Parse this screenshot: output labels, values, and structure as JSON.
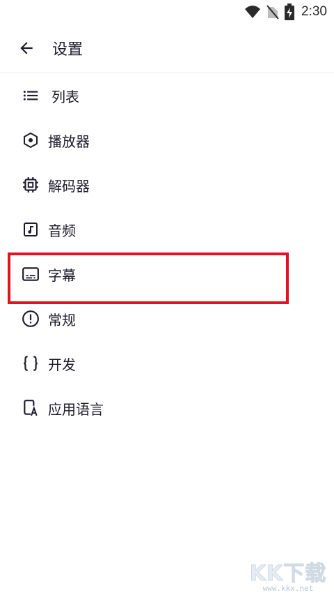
{
  "status_bar": {
    "time": "2:30",
    "icons": [
      "wifi-icon",
      "no-sim-icon",
      "battery-charging-icon"
    ]
  },
  "app_bar": {
    "back_icon": "arrow-left-icon",
    "title": "设置"
  },
  "menu": {
    "items": [
      {
        "label": "列表",
        "icon": "list-icon"
      },
      {
        "label": "播放器",
        "icon": "hexagon-dot-icon"
      },
      {
        "label": "解码器",
        "icon": "chip-icon"
      },
      {
        "label": "音频",
        "icon": "music-note-icon"
      },
      {
        "label": "字幕",
        "icon": "subtitles-icon"
      },
      {
        "label": "常规",
        "icon": "alert-circle-icon"
      },
      {
        "label": "开发",
        "icon": "code-braces-icon"
      },
      {
        "label": "应用语言",
        "icon": "app-language-icon"
      }
    ],
    "highlighted_item": "字幕"
  },
  "watermark": {
    "logo": "KK下载",
    "url": "www.kkx.net"
  },
  "colors": {
    "text": "#1f1b2e",
    "highlight_border": "#e0141e",
    "divider": "#ececec"
  }
}
